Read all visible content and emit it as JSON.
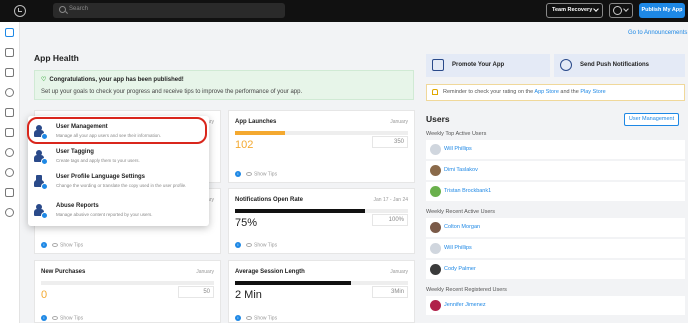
{
  "topbar": {
    "search_placeholder": "Search",
    "team_label": "Team Recovery",
    "publish_label": "Publish My App"
  },
  "sidebar": {
    "items": [
      "dashboard-icon",
      "edit-icon",
      "pages-icon",
      "design-icon",
      "features-icon",
      "store-icon",
      "notifications-icon",
      "users-icon",
      "analytics-icon",
      "settings-icon"
    ]
  },
  "main": {
    "goto_announcements": "Go to Announcements",
    "title": "App Health",
    "congrats_title": "Congratulations, your app has been published!",
    "congrats_sub": "Set up your goals to check your progress and receive tips to improve the performance of your app.",
    "cards": [
      {
        "title": "App Launches",
        "period": "January",
        "value": "102",
        "target": "350",
        "progress": 0.29,
        "bar_color": "#f4a930",
        "value_color": "#f4a930"
      },
      {
        "title": "Notifications Open Rate",
        "period": "Jan 17 - Jan 24",
        "value": "75%",
        "target": "100%",
        "progress": 0.75,
        "bar_color": "#111111",
        "value_color": "#222222"
      },
      {
        "title": "New Purchases",
        "period": "January",
        "value": "0",
        "target": "50",
        "progress": 0,
        "bar_color": "#f4a930",
        "value_color": "#f4a930"
      },
      {
        "title": "Average Session Length",
        "period": "January",
        "value": "2 Min",
        "target": "3Min",
        "progress": 0.67,
        "bar_color": "#111111",
        "value_color": "#222222"
      }
    ],
    "left_top_period": "January",
    "left_mid_period": "January",
    "show_tips": "Show Tips"
  },
  "right": {
    "promote_label": "Promote Your App",
    "push_label": "Send Push Notifications",
    "reminder_prefix": "Reminder to check your rating on the",
    "reminder_app_store": "App Store",
    "reminder_and": "and the",
    "reminder_play_store": "Play Store",
    "users_title": "Users",
    "user_mgmt_button": "User Management",
    "weekly_top_active": "Weekly Top Active Users",
    "top_active": [
      "Will Phillips",
      "Dimi Taslakov",
      "Tristan Brockbank1"
    ],
    "weekly_recent_active": "Weekly Recent Active Users",
    "recent_active": [
      "Colton Morgan",
      "Will Phillips",
      "Cody Palmer"
    ],
    "weekly_recent_registered": "Weekly Recent Registered Users",
    "recent_registered": [
      "Jennifer Jimenez"
    ]
  },
  "popup": {
    "items": [
      {
        "title": "User Management",
        "desc": "Manage all your app users and see their information."
      },
      {
        "title": "User Tagging",
        "desc": "Create tags and apply them to your users."
      },
      {
        "title": "User Profile Language Settings",
        "desc": "Change the wording or translate the copy used in the user profile."
      },
      {
        "title": "Abuse Reports",
        "desc": "Manage abusive content reported by your users."
      }
    ]
  },
  "colors": {
    "accent": "#1e88e5",
    "highlight": "#d9261c",
    "progress_orange": "#f4a930"
  }
}
